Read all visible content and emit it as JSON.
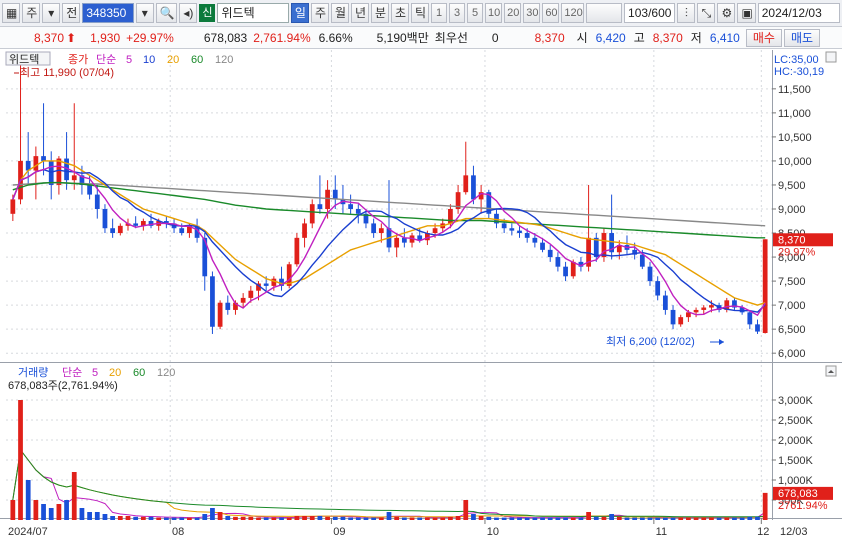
{
  "toolbar": {
    "tab_ju": "주",
    "tab_jeon": "전",
    "code": "348350",
    "badge": "신",
    "name": "위드텍",
    "periods": [
      "일",
      "주",
      "월",
      "년",
      "분",
      "초",
      "틱"
    ],
    "active_period": "일",
    "multipliers": [
      "1",
      "3",
      "5",
      "10",
      "20",
      "30",
      "60",
      "120"
    ],
    "count": "103/600",
    "date": "2024/12/03"
  },
  "infobar": {
    "price": "8,370",
    "change": "1,930",
    "change_pct": "+29.97%",
    "volume": "678,083",
    "volume_pct": "2,761.94%",
    "turnover": "6.66%",
    "amount": "5,190백만",
    "best_bid_label": "최우선",
    "best_bid": "0",
    "best_ask": "8,370",
    "open_label": "시",
    "open": "6,420",
    "high_label": "고",
    "high": "8,370",
    "low_label": "저",
    "low": "6,410",
    "buy_label": "매수",
    "sell_label": "매도"
  },
  "price_panel": {
    "name_tag": "위드텍",
    "legend_close": "종가",
    "legend_type": "단순",
    "ma": [
      {
        "period": "5",
        "color": "#c020c0"
      },
      {
        "period": "10",
        "color": "#1a3fd0"
      },
      {
        "period": "20",
        "color": "#e8a000"
      },
      {
        "period": "60",
        "color": "#1a8a2a"
      },
      {
        "period": "120",
        "color": "#888888"
      }
    ],
    "high_note": "최고 11,990 (07/04)",
    "low_note": "최저 6,200 (12/02)",
    "lc_label": "LC:35,00",
    "hc_label": "HC:-30,19",
    "y_ticks": [
      "11,500",
      "11,000",
      "10,500",
      "10,000",
      "9,500",
      "9,000",
      "8,500",
      "8,000",
      "7,500",
      "7,000",
      "6,500",
      "6,000"
    ],
    "current_price_tag": "8,370",
    "current_pct_tag": "29.97%"
  },
  "volume_panel": {
    "legend_label": "거래량",
    "legend_type": "단순",
    "ma": [
      {
        "period": "5",
        "color": "#c020c0"
      },
      {
        "period": "20",
        "color": "#e8a000"
      },
      {
        "period": "60",
        "color": "#1a8a2a"
      },
      {
        "period": "120",
        "color": "#888888"
      }
    ],
    "vol_note": "678,083주(2,761.94%)",
    "y_ticks": [
      "3,000K",
      "2,500K",
      "2,000K",
      "1,500K",
      "1,000K",
      "500K"
    ],
    "current_vol_tag": "678,083",
    "current_vol_pct_tag": "2761.94%"
  },
  "x_axis": {
    "labels": [
      "2024/07",
      "08",
      "09",
      "10",
      "11",
      "12"
    ],
    "right_label": "12/03"
  },
  "colors": {
    "up": "#e0201a",
    "down": "#1a50d8"
  },
  "chart_data": {
    "type": "candlestick",
    "ylim": [
      5900,
      12100
    ],
    "vol_max_k": 3500,
    "candles": [
      [
        8900,
        9300,
        8750,
        9200,
        500
      ],
      [
        9200,
        12000,
        9100,
        10000,
        3000
      ],
      [
        10000,
        10600,
        9500,
        9800,
        1000
      ],
      [
        9800,
        10300,
        9200,
        10100,
        500
      ],
      [
        10100,
        11200,
        9700,
        10000,
        400
      ],
      [
        10000,
        10200,
        9200,
        9500,
        300
      ],
      [
        9500,
        10100,
        9300,
        10050,
        400
      ],
      [
        10050,
        10600,
        9400,
        9600,
        500
      ],
      [
        9600,
        11200,
        9400,
        9700,
        1200
      ],
      [
        9700,
        9900,
        9300,
        9500,
        300
      ],
      [
        9500,
        9700,
        9200,
        9300,
        200
      ],
      [
        9300,
        9500,
        8800,
        9000,
        200
      ],
      [
        9000,
        9100,
        8500,
        8600,
        150
      ],
      [
        8600,
        8800,
        8400,
        8500,
        100
      ],
      [
        8500,
        8700,
        8450,
        8650,
        100
      ],
      [
        8650,
        8800,
        8550,
        8700,
        100
      ],
      [
        8700,
        8850,
        8600,
        8650,
        80
      ],
      [
        8650,
        8800,
        8550,
        8750,
        80
      ],
      [
        8750,
        8900,
        8600,
        8650,
        80
      ],
      [
        8650,
        8800,
        8550,
        8750,
        60
      ],
      [
        8750,
        8850,
        8600,
        8700,
        60
      ],
      [
        8700,
        8800,
        8500,
        8600,
        60
      ],
      [
        8600,
        8700,
        8450,
        8500,
        60
      ],
      [
        8500,
        8700,
        8400,
        8650,
        60
      ],
      [
        8650,
        8800,
        8300,
        8400,
        60
      ],
      [
        8400,
        8500,
        7300,
        7600,
        150
      ],
      [
        7600,
        7700,
        6400,
        6550,
        300
      ],
      [
        6550,
        7100,
        6500,
        7050,
        200
      ],
      [
        7050,
        7200,
        6800,
        6900,
        100
      ],
      [
        6900,
        7100,
        6800,
        7050,
        80
      ],
      [
        7050,
        7250,
        6950,
        7150,
        80
      ],
      [
        7150,
        7400,
        7050,
        7300,
        80
      ],
      [
        7300,
        7500,
        7100,
        7450,
        60
      ],
      [
        7450,
        7600,
        7300,
        7400,
        60
      ],
      [
        7400,
        7600,
        7300,
        7550,
        60
      ],
      [
        7550,
        7800,
        7300,
        7400,
        60
      ],
      [
        7400,
        7900,
        7350,
        7850,
        60
      ],
      [
        7850,
        8500,
        7800,
        8400,
        100
      ],
      [
        8400,
        8800,
        8200,
        8700,
        100
      ],
      [
        8700,
        9200,
        8600,
        9100,
        100
      ],
      [
        9100,
        9700,
        8900,
        9000,
        100
      ],
      [
        9000,
        9600,
        8800,
        9400,
        80
      ],
      [
        9400,
        9700,
        9000,
        9200,
        80
      ],
      [
        9200,
        9500,
        8900,
        9100,
        80
      ],
      [
        9100,
        9300,
        8900,
        9000,
        60
      ],
      [
        9000,
        9100,
        8700,
        8900,
        60
      ],
      [
        8900,
        9000,
        8600,
        8700,
        60
      ],
      [
        8700,
        8800,
        8400,
        8500,
        60
      ],
      [
        8500,
        8700,
        8300,
        8600,
        60
      ],
      [
        8600,
        9600,
        8100,
        8200,
        200
      ],
      [
        8200,
        8500,
        8000,
        8400,
        80
      ],
      [
        8400,
        8600,
        8200,
        8300,
        60
      ],
      [
        8300,
        8500,
        8200,
        8450,
        60
      ],
      [
        8450,
        8600,
        8300,
        8350,
        60
      ],
      [
        8350,
        8550,
        8250,
        8500,
        60
      ],
      [
        8500,
        8700,
        8400,
        8600,
        60
      ],
      [
        8600,
        8800,
        8500,
        8700,
        60
      ],
      [
        8700,
        9100,
        8600,
        9000,
        80
      ],
      [
        9000,
        9500,
        8900,
        9350,
        100
      ],
      [
        9350,
        10400,
        9300,
        9700,
        500
      ],
      [
        9700,
        9900,
        9100,
        9200,
        150
      ],
      [
        9200,
        9500,
        8900,
        9350,
        100
      ],
      [
        9350,
        9400,
        8800,
        8900,
        80
      ],
      [
        8900,
        9000,
        8600,
        8700,
        60
      ],
      [
        8700,
        8800,
        8500,
        8600,
        60
      ],
      [
        8600,
        8700,
        8450,
        8550,
        60
      ],
      [
        8550,
        8650,
        8400,
        8500,
        60
      ],
      [
        8500,
        8600,
        8300,
        8400,
        60
      ],
      [
        8400,
        8500,
        8200,
        8300,
        60
      ],
      [
        8300,
        8400,
        8100,
        8150,
        60
      ],
      [
        8150,
        8250,
        7900,
        8000,
        60
      ],
      [
        8000,
        8100,
        7700,
        7800,
        60
      ],
      [
        7800,
        7900,
        7500,
        7600,
        60
      ],
      [
        7600,
        7950,
        7550,
        7900,
        60
      ],
      [
        7900,
        8000,
        7700,
        7800,
        60
      ],
      [
        7800,
        9500,
        7700,
        8400,
        200
      ],
      [
        8400,
        8500,
        7900,
        8000,
        80
      ],
      [
        8000,
        8600,
        7900,
        8500,
        80
      ],
      [
        8500,
        9300,
        7950,
        8100,
        150
      ],
      [
        8100,
        8350,
        7950,
        8250,
        80
      ],
      [
        8250,
        8450,
        8050,
        8150,
        60
      ],
      [
        8150,
        8300,
        7950,
        8050,
        60
      ],
      [
        8050,
        8150,
        7750,
        7800,
        60
      ],
      [
        7800,
        7900,
        7400,
        7500,
        60
      ],
      [
        7500,
        7600,
        7100,
        7200,
        60
      ],
      [
        7200,
        7300,
        6800,
        6900,
        60
      ],
      [
        6900,
        7000,
        6500,
        6600,
        60
      ],
      [
        6600,
        6800,
        6550,
        6750,
        60
      ],
      [
        6750,
        6900,
        6650,
        6850,
        60
      ],
      [
        6850,
        6950,
        6750,
        6900,
        60
      ],
      [
        6900,
        7000,
        6800,
        6950,
        60
      ],
      [
        6950,
        7100,
        6850,
        7000,
        60
      ],
      [
        7000,
        7050,
        6850,
        6900,
        60
      ],
      [
        6900,
        7150,
        6850,
        7100,
        60
      ],
      [
        7100,
        7150,
        6900,
        6950,
        60
      ],
      [
        6950,
        7000,
        6800,
        6850,
        60
      ],
      [
        6850,
        6900,
        6500,
        6600,
        80
      ],
      [
        6600,
        6700,
        6400,
        6450,
        80
      ],
      [
        6420,
        8370,
        6410,
        8370,
        678
      ]
    ],
    "ma20": [
      9200,
      9600,
      9800,
      9900,
      10000,
      10000,
      10000,
      9950,
      9900,
      9800,
      9700,
      9600,
      9500,
      9400,
      9300,
      9200,
      9100,
      9000,
      8950,
      8900,
      8850,
      8800,
      8750,
      8700,
      8650,
      8550,
      8400,
      8250,
      8100,
      7950,
      7850,
      7750,
      7650,
      7550,
      7500,
      7450,
      7450,
      7500,
      7550,
      7650,
      7750,
      7850,
      7950,
      8050,
      8150,
      8200,
      8250,
      8300,
      8350,
      8400,
      8450,
      8500,
      8550,
      8600,
      8650,
      8650,
      8650,
      8700,
      8750,
      8800,
      8800,
      8800,
      8800,
      8780,
      8760,
      8740,
      8720,
      8700,
      8680,
      8650,
      8600,
      8550,
      8500,
      8450,
      8400,
      8380,
      8360,
      8340,
      8320,
      8300,
      8280,
      8250,
      8200,
      8150,
      8100,
      8050,
      7950,
      7850,
      7750,
      7650,
      7550,
      7450,
      7350,
      7250,
      7150,
      7100,
      7050,
      7000,
      7050
    ],
    "ma60": [
      9400,
      9450,
      9500,
      9520,
      9540,
      9550,
      9550,
      9540,
      9530,
      9520,
      9500,
      9480,
      9460,
      9440,
      9420,
      9400,
      9380,
      9360,
      9340,
      9320,
      9300,
      9280,
      9260,
      9240,
      9220,
      9200,
      9170,
      9140,
      9110,
      9080,
      9060,
      9040,
      9020,
      9000,
      8990,
      8980,
      8970,
      8960,
      8950,
      8940,
      8930,
      8920,
      8910,
      8900,
      8890,
      8880,
      8870,
      8860,
      8850,
      8840,
      8830,
      8820,
      8810,
      8800,
      8790,
      8780,
      8770,
      8760,
      8760,
      8760,
      8760,
      8760,
      8750,
      8740,
      8730,
      8720,
      8710,
      8700,
      8690,
      8680,
      8670,
      8660,
      8650,
      8640,
      8630,
      8620,
      8610,
      8600,
      8590,
      8580,
      8570,
      8560,
      8550,
      8540,
      8530,
      8520,
      8510,
      8500,
      8490,
      8480,
      8470,
      8460,
      8450,
      8440,
      8430,
      8420,
      8410,
      8400,
      8400
    ],
    "ma120": [
      9500,
      9510,
      9520,
      9530,
      9540,
      9545,
      9545,
      9540,
      9535,
      9530,
      9525,
      9520,
      9510,
      9500,
      9490,
      9480,
      9470,
      9460,
      9450,
      9440,
      9430,
      9420,
      9410,
      9400,
      9390,
      9380,
      9370,
      9360,
      9350,
      9340,
      9330,
      9320,
      9310,
      9300,
      9290,
      9280,
      9270,
      9260,
      9250,
      9240,
      9230,
      9220,
      9210,
      9200,
      9190,
      9180,
      9170,
      9160,
      9150,
      9140,
      9130,
      9120,
      9110,
      9100,
      9090,
      9080,
      9070,
      9060,
      9050,
      9040,
      9030,
      9020,
      9010,
      9000,
      8990,
      8980,
      8970,
      8960,
      8950,
      8940,
      8930,
      8920,
      8910,
      8900,
      8890,
      8880,
      8870,
      8860,
      8850,
      8840,
      8830,
      8820,
      8810,
      8800,
      8790,
      8780,
      8770,
      8760,
      8750,
      8740,
      8730,
      8720,
      8710,
      8700,
      8690,
      8680,
      8670,
      8660,
      8650
    ]
  }
}
